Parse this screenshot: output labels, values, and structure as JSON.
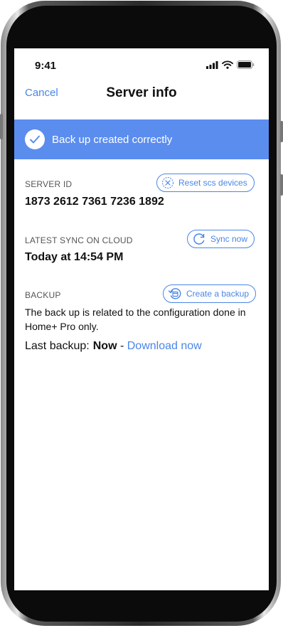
{
  "status_bar": {
    "time": "9:41"
  },
  "nav": {
    "cancel_label": "Cancel",
    "title": "Server info"
  },
  "banner": {
    "text": "Back up created correctly",
    "color": "#5b8def"
  },
  "server_id": {
    "label": "SERVER ID",
    "value": "1873 2612 7361 7236 1892",
    "button_label": "Reset scs devices"
  },
  "sync": {
    "label": "LATEST SYNC ON CLOUD",
    "value": "Today at 14:54 PM",
    "button_label": "Sync now"
  },
  "backup": {
    "label": "BACKUP",
    "button_label": "Create a backup",
    "description": "The back up is related to the configuration done in Home+ Pro only.",
    "last_backup_label": "Last backup:",
    "last_backup_value": "Now",
    "separator": "-",
    "download_label": "Download now"
  },
  "colors": {
    "accent": "#4a86e8",
    "banner": "#5b8def"
  }
}
